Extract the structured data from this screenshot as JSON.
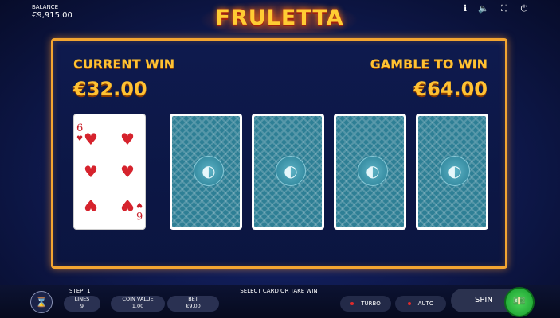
{
  "header": {
    "balance_label": "BALANCE",
    "balance_value": "€9,915.00",
    "logo": "FRULETTA",
    "icons": [
      "info-icon",
      "sound-icon",
      "fullscreen-icon",
      "power-icon"
    ]
  },
  "gamble": {
    "current_win_label": "CURRENT WIN",
    "current_win_value": "€32.00",
    "gamble_label": "GAMBLE TO WIN",
    "gamble_value": "€64.00"
  },
  "cards": {
    "face": {
      "rank": "6",
      "suit": "hearts",
      "symbol": "♥"
    },
    "back_count": 4
  },
  "footer": {
    "step": "STEP: 1",
    "message": "SELECT CARD OR TAKE WIN",
    "lines_label": "LINES",
    "lines_value": "9",
    "coin_label": "COIN VALUE",
    "coin_value": "1.00",
    "bet_label": "BET",
    "bet_value": "€9.00",
    "turbo_label": "TURBO",
    "auto_label": "AUTO",
    "spin_label": "SPIN"
  },
  "colors": {
    "accent": "#f3a531",
    "win_text": "#ffc233",
    "card_back": "#2e7f95",
    "spin": "#22b537"
  }
}
